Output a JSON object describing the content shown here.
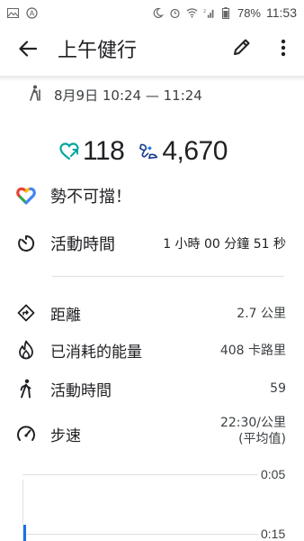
{
  "status_bar": {
    "battery": "78%",
    "time": "11:53"
  },
  "app_bar": {
    "title": "上午健行"
  },
  "session": {
    "date_range": "8月9日 10:24 — 11:24"
  },
  "metrics": {
    "heart_points": "118",
    "steps": "4,670"
  },
  "goal": {
    "message": "勢不可擋！"
  },
  "duration": {
    "label": "活動時間",
    "value": "1 小時 00 分鐘 51 秒"
  },
  "stats": [
    {
      "label": "距離",
      "value": "2.7 公里",
      "icon": "location-icon"
    },
    {
      "label": "已消耗的能量",
      "value": "408 卡路里",
      "icon": "flame-icon"
    },
    {
      "label": "活動時間",
      "value": "59",
      "icon": "walking-icon"
    },
    {
      "label": "步速",
      "value": "22:30/公里",
      "value2": "(平均值)",
      "icon": "speedometer-icon"
    }
  ],
  "chart": {
    "ticks": [
      "0:05",
      "0:15"
    ]
  },
  "colors": {
    "teal": "#00a79d",
    "blue": "#1a73e8",
    "dark_blue": "#1a3d8f"
  }
}
